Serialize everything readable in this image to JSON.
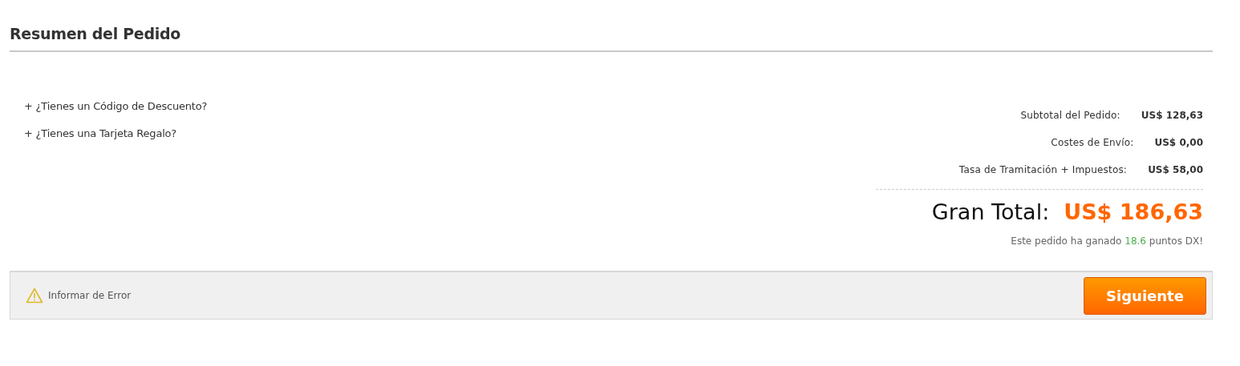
{
  "title": "Resumen del Pedido",
  "links": [
    {
      "label": "+ ¿Tienes un Código de Descuento?"
    },
    {
      "label": "+ ¿Tienes una Tarjeta Regalo?"
    }
  ],
  "summary": [
    {
      "label": "Subtotal del Pedido:",
      "value": "US$ 128,63"
    },
    {
      "label": "Costes de Envío:",
      "value": "US$ 0,00"
    },
    {
      "label": "Tasa de Tramitación + Impuestos:",
      "value": "US$ 58,00"
    }
  ],
  "grand_total": {
    "label": "Gran Total:",
    "value": "US$ 186,63"
  },
  "points": {
    "before": "Este pedido ha ganado",
    "points": "18.6",
    "after": "puntos DX!"
  },
  "footer": {
    "report_link": "Informar de Error",
    "next_button": "Siguiente"
  }
}
